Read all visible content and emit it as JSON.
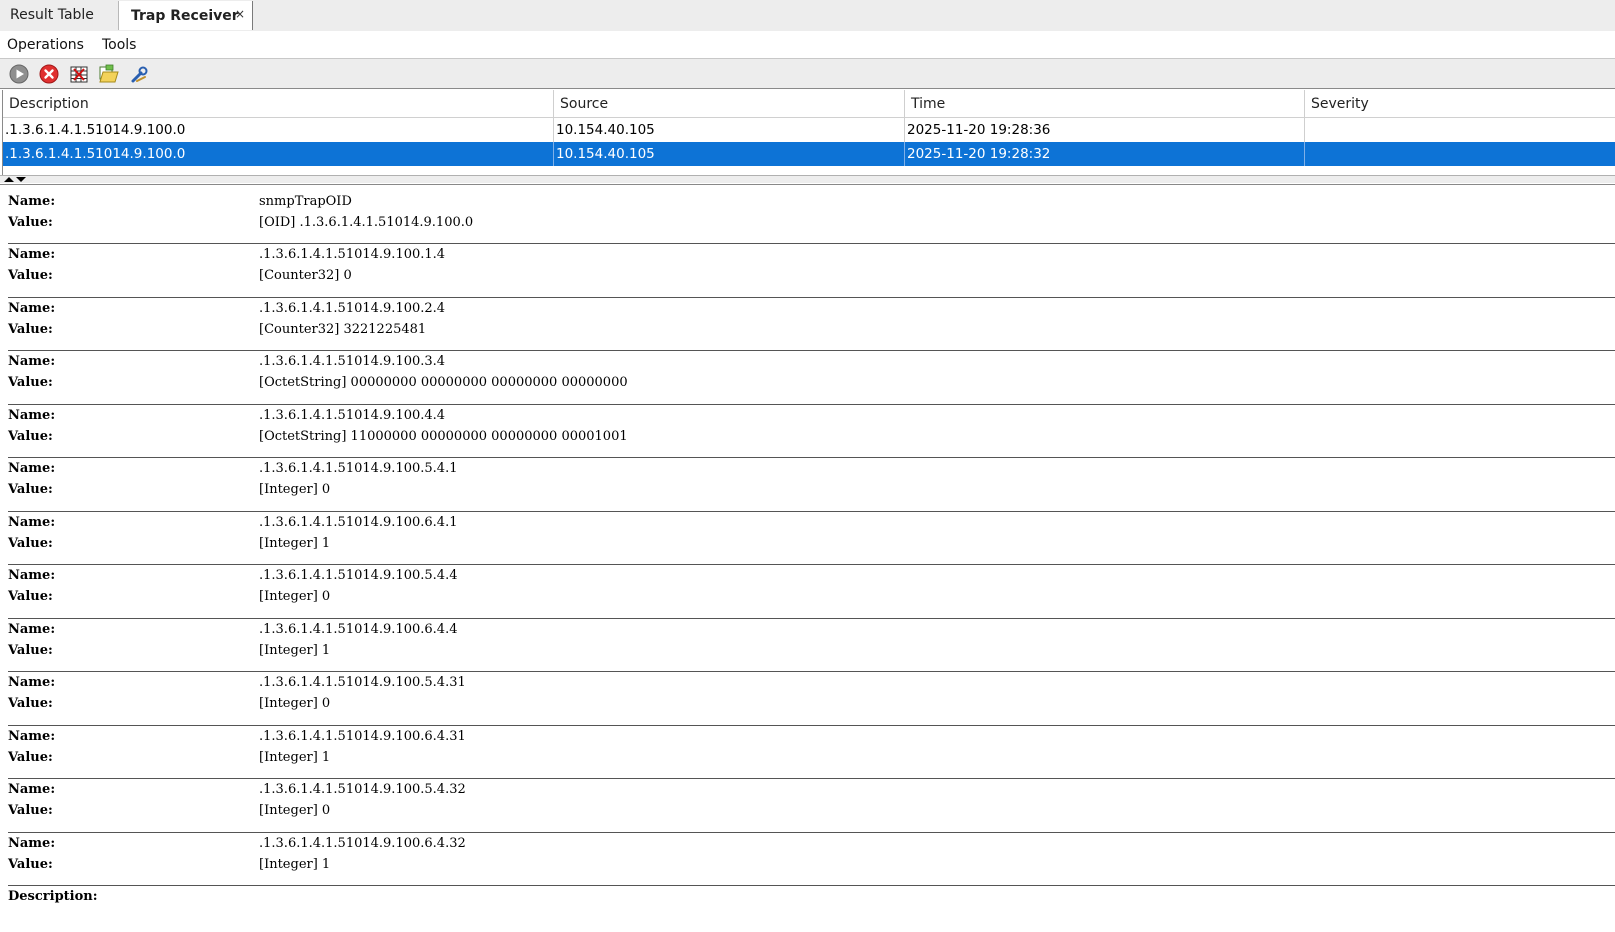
{
  "tabs": [
    {
      "label": "Result Table",
      "active": false
    },
    {
      "label": "Trap Receiver",
      "active": true,
      "close": "×"
    }
  ],
  "menu": [
    "Operations",
    "Tools"
  ],
  "toolbar": {
    "icons": [
      "start-icon",
      "stop-icon",
      "clear-table-icon",
      "open-folder-icon",
      "settings-tools-icon"
    ]
  },
  "table": {
    "columns": [
      "Description",
      "Source",
      "Time",
      "Severity"
    ],
    "rows": [
      {
        "description": ".1.3.6.1.4.1.51014.9.100.0",
        "source": "10.154.40.105",
        "time": "2025-11-20 19:28:36",
        "severity": ""
      },
      {
        "description": ".1.3.6.1.4.1.51014.9.100.0",
        "source": "10.154.40.105",
        "time": "2025-11-20 19:28:32",
        "severity": ""
      }
    ],
    "selected_row": 1
  },
  "detail": {
    "name_label": "Name:",
    "value_label": "Value:",
    "description_label": "Description:",
    "entries": [
      {
        "name": "snmpTrapOID",
        "value": "[OID] .1.3.6.1.4.1.51014.9.100.0"
      },
      {
        "name": ".1.3.6.1.4.1.51014.9.100.1.4",
        "value": "[Counter32] 0"
      },
      {
        "name": ".1.3.6.1.4.1.51014.9.100.2.4",
        "value": "[Counter32] 3221225481"
      },
      {
        "name": ".1.3.6.1.4.1.51014.9.100.3.4",
        "value": "[OctetString] 00000000 00000000 00000000 00000000"
      },
      {
        "name": ".1.3.6.1.4.1.51014.9.100.4.4",
        "value": "[OctetString] 11000000 00000000 00000000 00001001"
      },
      {
        "name": ".1.3.6.1.4.1.51014.9.100.5.4.1",
        "value": "[Integer] 0"
      },
      {
        "name": ".1.3.6.1.4.1.51014.9.100.6.4.1",
        "value": "[Integer] 1"
      },
      {
        "name": ".1.3.6.1.4.1.51014.9.100.5.4.4",
        "value": "[Integer] 0"
      },
      {
        "name": ".1.3.6.1.4.1.51014.9.100.6.4.4",
        "value": "[Integer] 1"
      },
      {
        "name": ".1.3.6.1.4.1.51014.9.100.5.4.31",
        "value": "[Integer] 0"
      },
      {
        "name": ".1.3.6.1.4.1.51014.9.100.6.4.31",
        "value": "[Integer] 1"
      },
      {
        "name": ".1.3.6.1.4.1.51014.9.100.5.4.32",
        "value": "[Integer] 0"
      },
      {
        "name": ".1.3.6.1.4.1.51014.9.100.6.4.32",
        "value": "[Integer] 1"
      }
    ]
  },
  "colors": {
    "selection": "#0d73d6",
    "toolbar_bg": "#ededed"
  }
}
